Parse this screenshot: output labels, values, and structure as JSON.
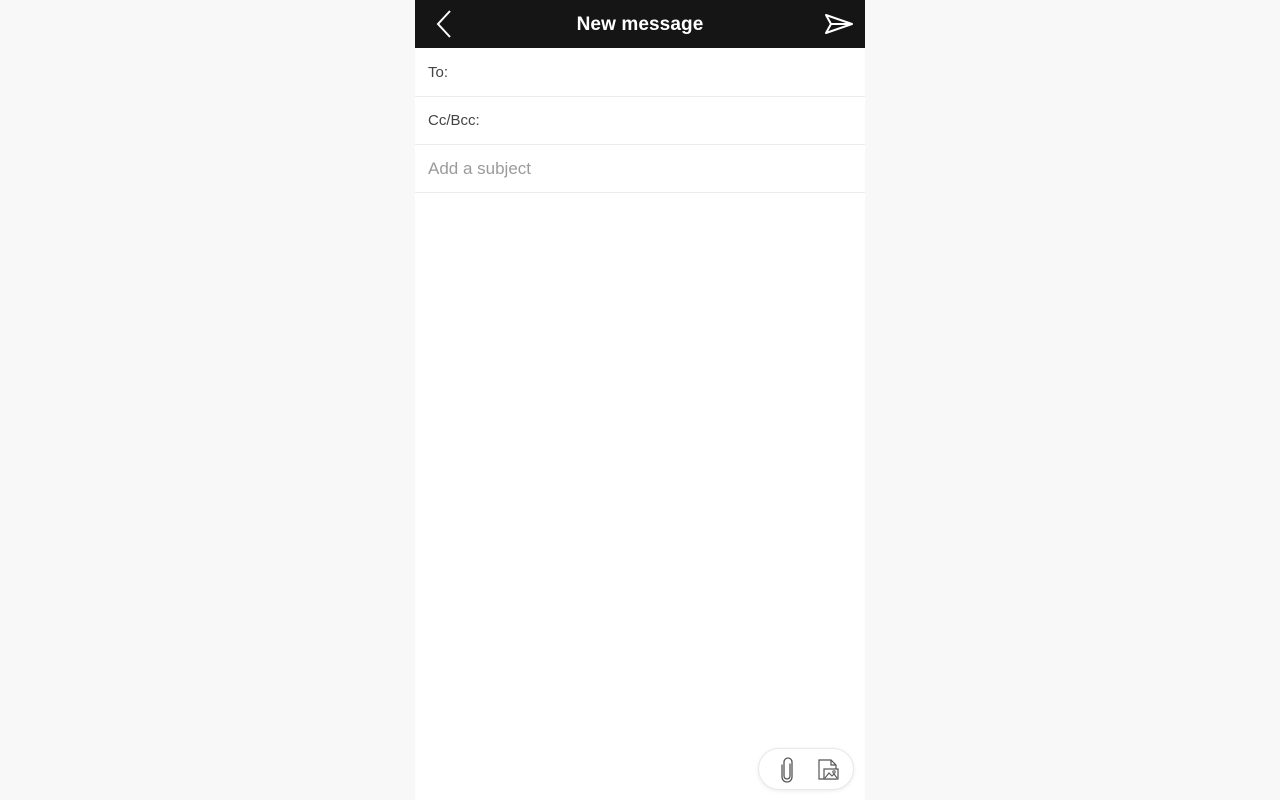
{
  "header": {
    "title": "New message",
    "back_icon": "chevron-left-icon",
    "send_icon": "send-icon"
  },
  "compose": {
    "to_label": "To:",
    "cc_label": "Cc/Bcc:",
    "subject_placeholder": "Add a subject"
  },
  "toolbar": {
    "attach_icon": "paperclip-icon",
    "image_icon": "image-icon"
  },
  "colors": {
    "header_bg": "#151515",
    "header_text": "#ffffff",
    "page_bg": "#f8f8f8",
    "compose_bg": "#ffffff",
    "divider": "#ececec"
  }
}
